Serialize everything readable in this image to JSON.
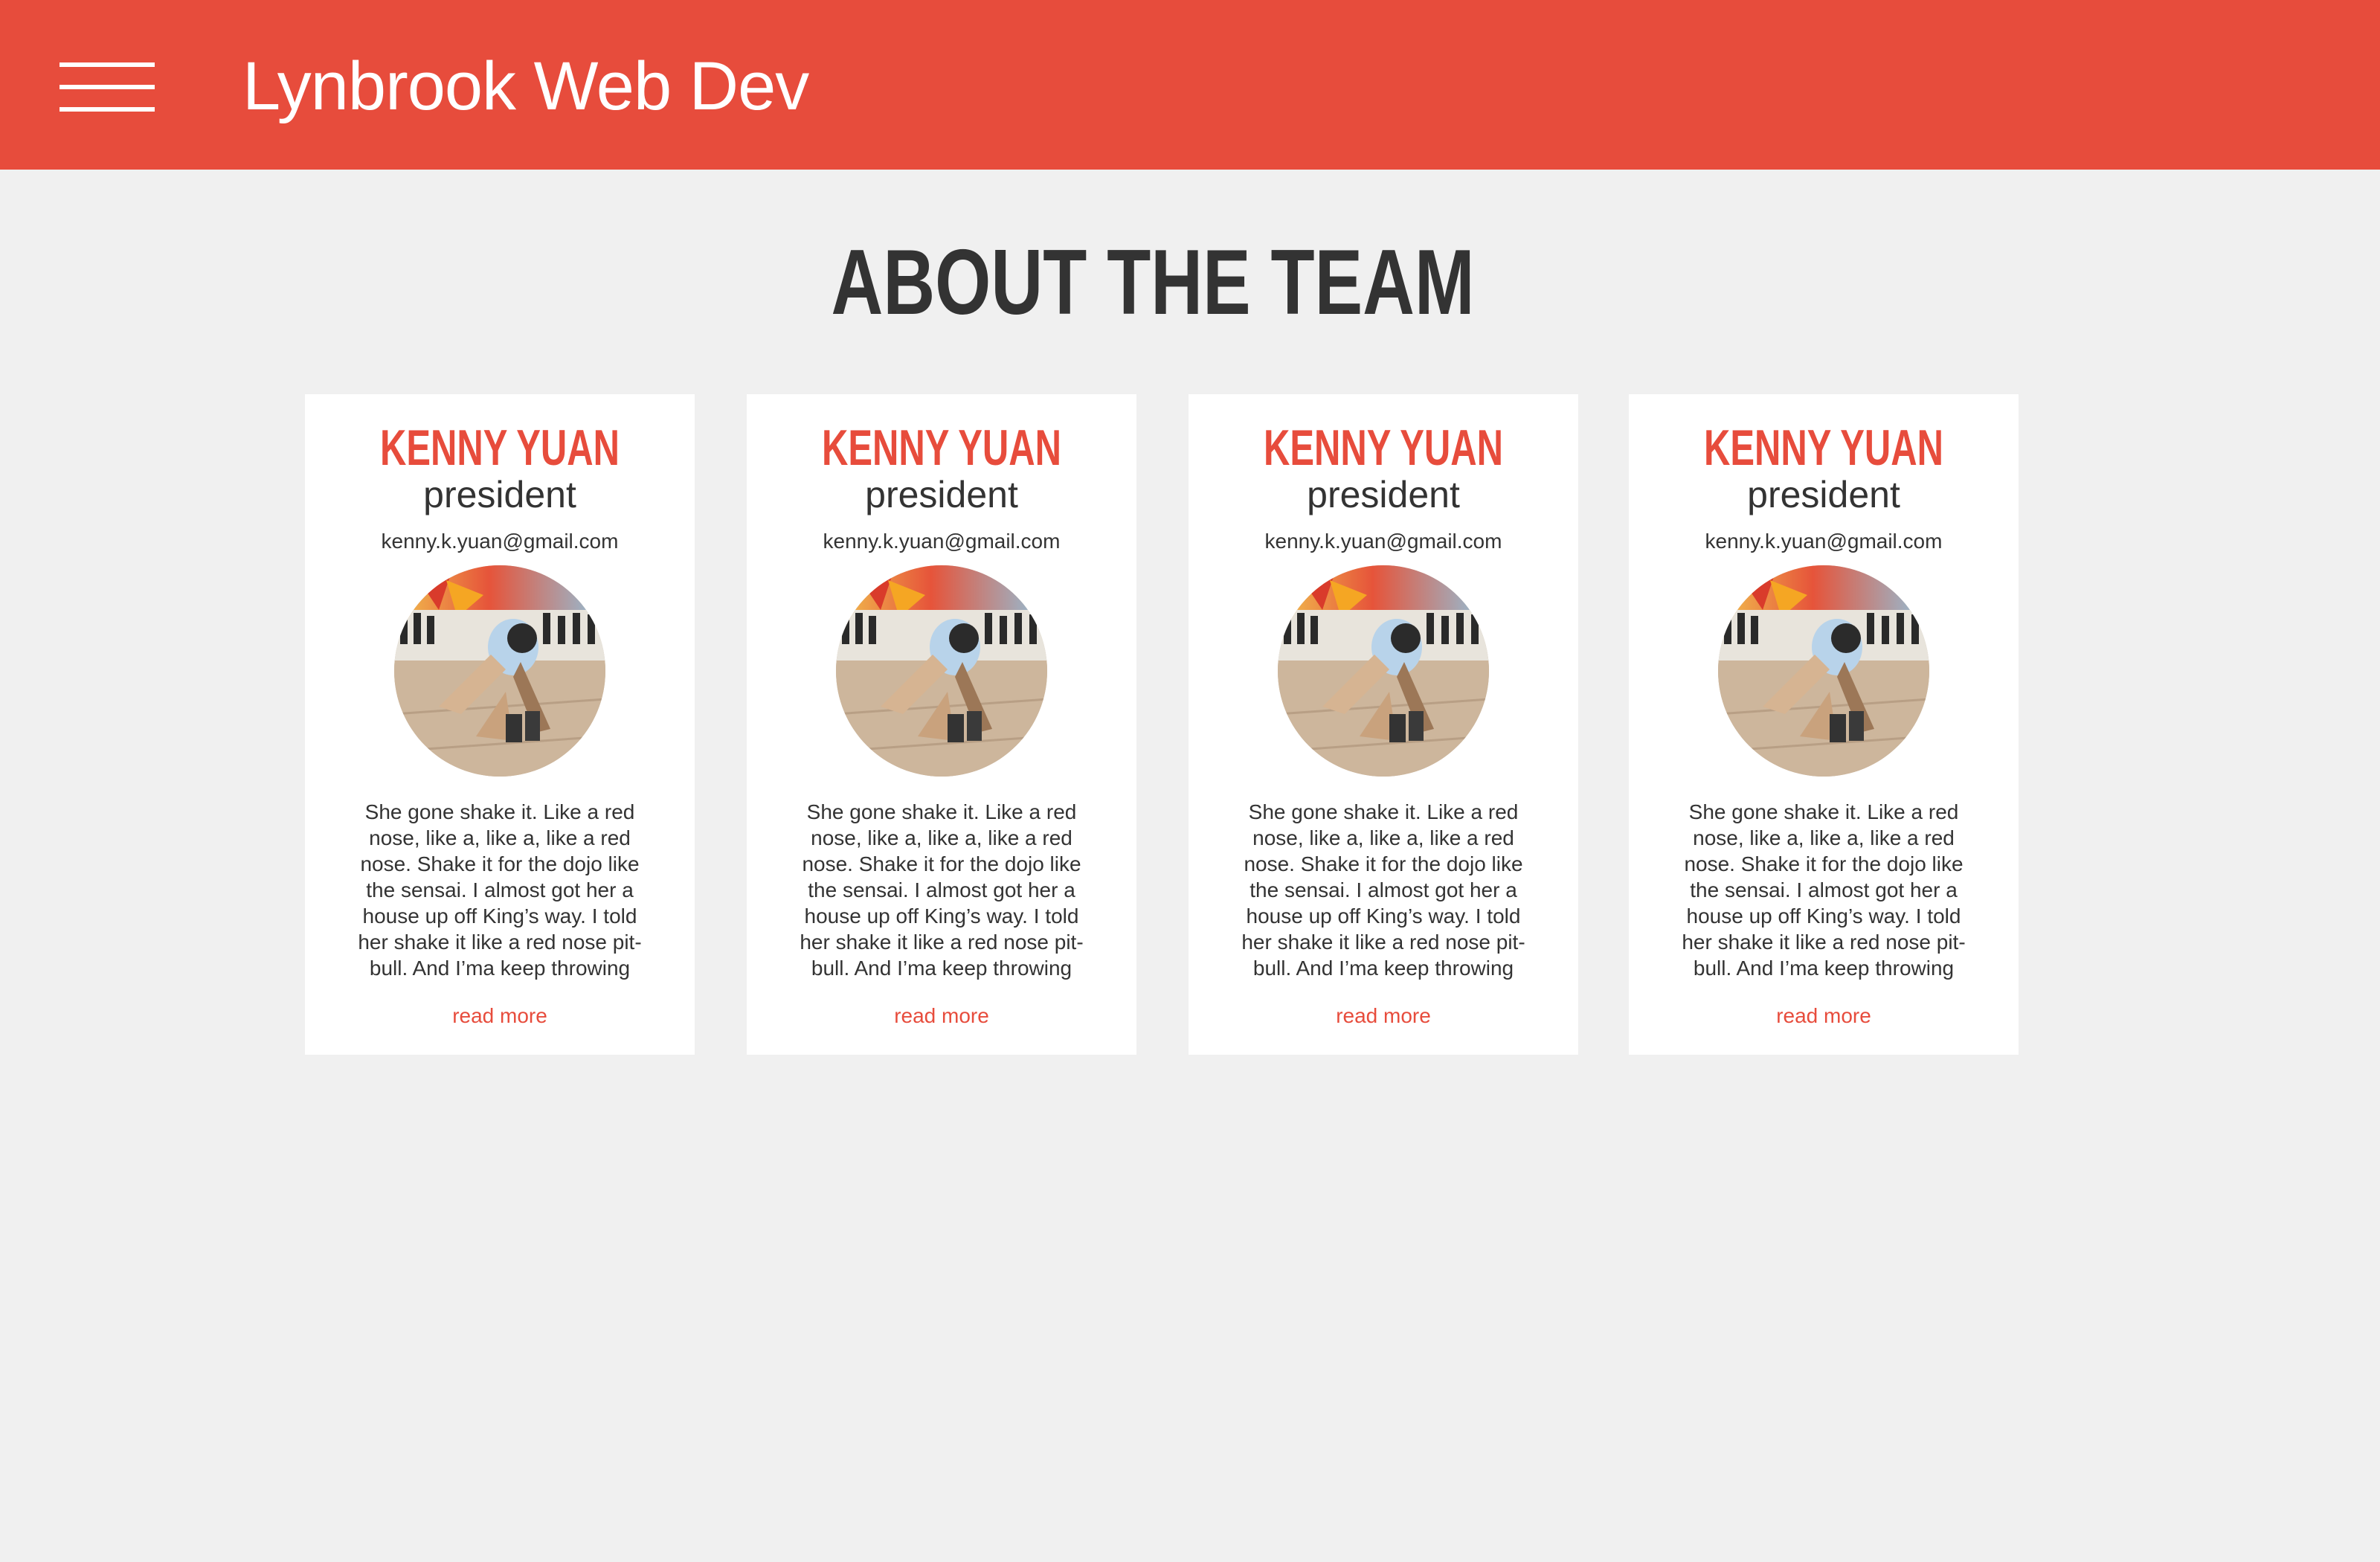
{
  "header": {
    "brand": "Lynbrook Web Dev",
    "menu_icon": "hamburger-menu-icon"
  },
  "main": {
    "title": "About the Team",
    "members": [
      {
        "name": "Kenny Yuan",
        "role": "president",
        "email": "kenny.k.yuan@gmail.com",
        "bio": "She gone shake it. Like a red nose, like a, like a, like a red nose. Shake it for the dojo like the sensai. I almost got her a house up off King’s way. I told her shake it like a red nose pit-bull. And I’ma keep throwing",
        "read_more": "read more"
      },
      {
        "name": "Kenny Yuan",
        "role": "president",
        "email": "kenny.k.yuan@gmail.com",
        "bio": "She gone shake it. Like a red nose, like a, like a, like a red nose. Shake it for the dojo like the sensai. I almost got her a house up off King’s way. I told her shake it like a red nose pit-bull. And I’ma keep throwing",
        "read_more": "read more"
      },
      {
        "name": "Kenny Yuan",
        "role": "president",
        "email": "kenny.k.yuan@gmail.com",
        "bio": "She gone shake it. Like a red nose, like a, like a, like a red nose. Shake it for the dojo like the sensai. I almost got her a house up off King’s way. I told her shake it like a red nose pit-bull. And I’ma keep throwing",
        "read_more": "read more"
      },
      {
        "name": "Kenny Yuan",
        "role": "president",
        "email": "kenny.k.yuan@gmail.com",
        "bio": "She gone shake it. Like a red nose, like a, like a, like a red nose. Shake it for the dojo like the sensai. I almost got her a house up off King’s way. I told her shake it like a red nose pit-bull. And I’ma keep throwing",
        "read_more": "read more"
      }
    ]
  },
  "colors": {
    "accent": "#e74c3c",
    "background": "#f0f0f0",
    "card": "#ffffff",
    "text": "#333333"
  }
}
